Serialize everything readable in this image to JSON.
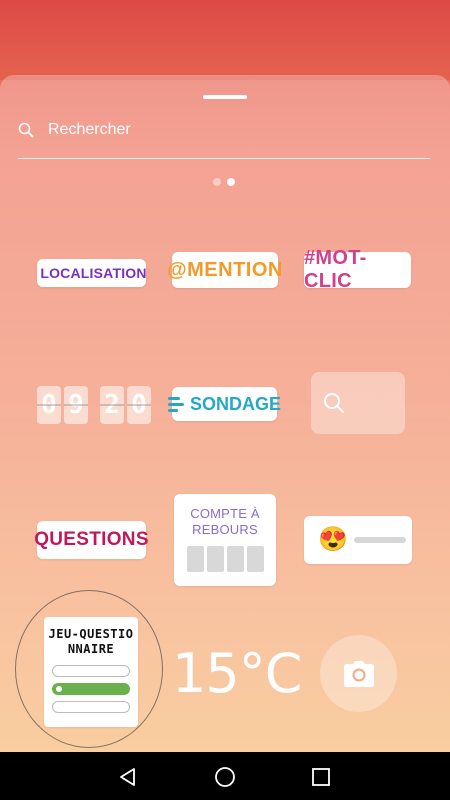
{
  "search": {
    "placeholder": "Rechercher"
  },
  "pager": {
    "pages": 2,
    "active_index": 1
  },
  "stickers": {
    "location": {
      "label": "LOCALISATION",
      "icon": "location-pin-icon",
      "color": "#7b2fbf"
    },
    "mention": {
      "label": "@MENTION",
      "color": "#f59a2a"
    },
    "hashtag": {
      "label": "#MOT-CLIC",
      "color": "#d2408a"
    },
    "clock": {
      "digits": [
        "0",
        "9",
        "2",
        "0"
      ]
    },
    "poll": {
      "label": "SONDAGE",
      "icon": "poll-lines-icon",
      "color": "#25a8c7"
    },
    "search": {
      "icon": "search-icon"
    },
    "questions": {
      "label": "QUESTIONS",
      "color": "#c2185b"
    },
    "countdown": {
      "label": "COMPTE À REBOURS",
      "color": "#8a6bd1"
    },
    "emoji_slider": {
      "emoji": "😍"
    },
    "quiz": {
      "label": "JEU-QUESTIONNAIRE",
      "options": 3,
      "correct_index": 1
    },
    "temperature": {
      "value": "15°C"
    },
    "camera": {
      "icon": "camera-icon"
    }
  },
  "navigation": {
    "back": "back-triangle-icon",
    "home": "home-circle-icon",
    "recent": "recent-square-icon"
  }
}
